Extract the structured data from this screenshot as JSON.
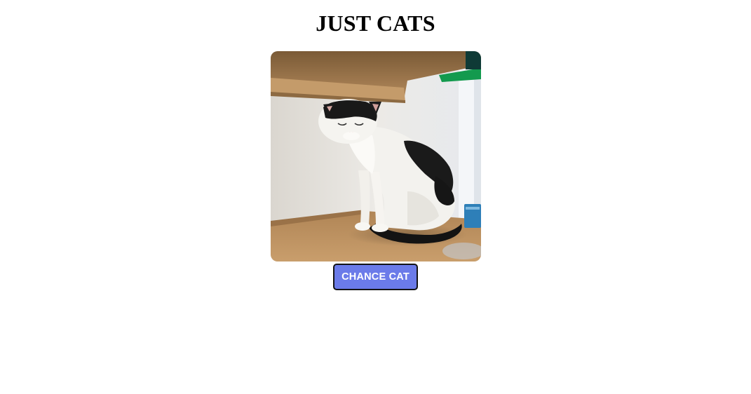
{
  "header": {
    "title": "JUST CATS"
  },
  "main": {
    "image": {
      "subject": "sleeping black-and-white cat sitting on a wooden shelf"
    },
    "button": {
      "label": "CHANCE CAT",
      "color": "#6b7be9"
    }
  }
}
